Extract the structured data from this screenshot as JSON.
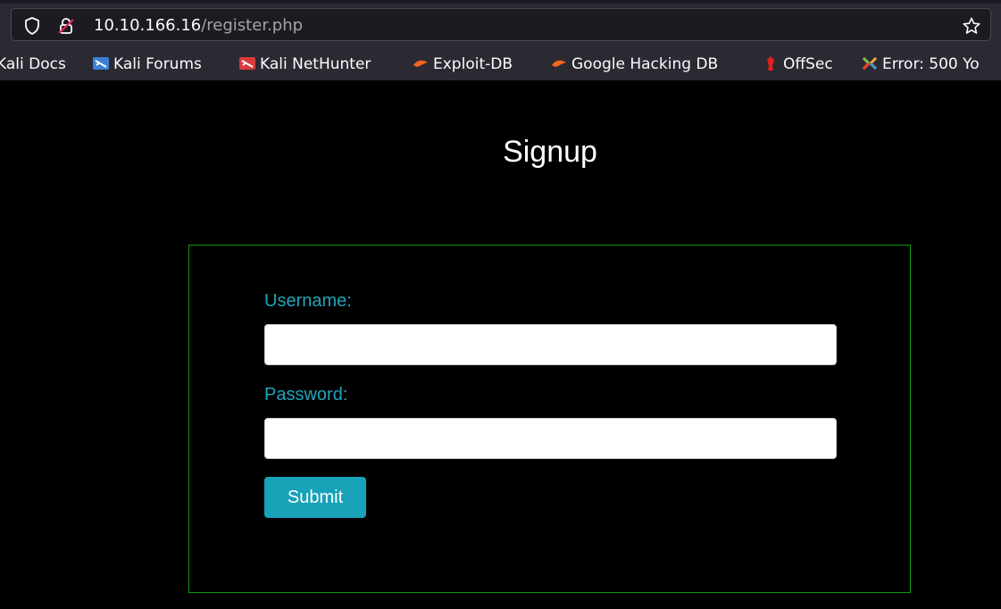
{
  "browser": {
    "url_host": "10.10.166.16",
    "url_path": "/register.php",
    "bookmarks": [
      {
        "label": "Kali Docs",
        "icon": "kali-docs-icon"
      },
      {
        "label": "Kali Forums",
        "icon": "kali-forums-icon"
      },
      {
        "label": "Kali NetHunter",
        "icon": "kali-nethunter-icon"
      },
      {
        "label": "Exploit-DB",
        "icon": "exploit-db-icon"
      },
      {
        "label": "Google Hacking DB",
        "icon": "google-hacking-db-icon"
      },
      {
        "label": "OffSec",
        "icon": "offsec-icon"
      },
      {
        "label": "Error: 500 Yo",
        "icon": "joomla-icon"
      }
    ]
  },
  "page": {
    "title": "Signup",
    "form": {
      "username_label": "Username:",
      "username_value": "",
      "password_label": "Password:",
      "password_value": "",
      "submit_label": "Submit"
    }
  },
  "colors": {
    "label": "#1fa5b9",
    "button": "#17a2b8",
    "form_border": "#0a9b0a",
    "background": "#000000"
  }
}
